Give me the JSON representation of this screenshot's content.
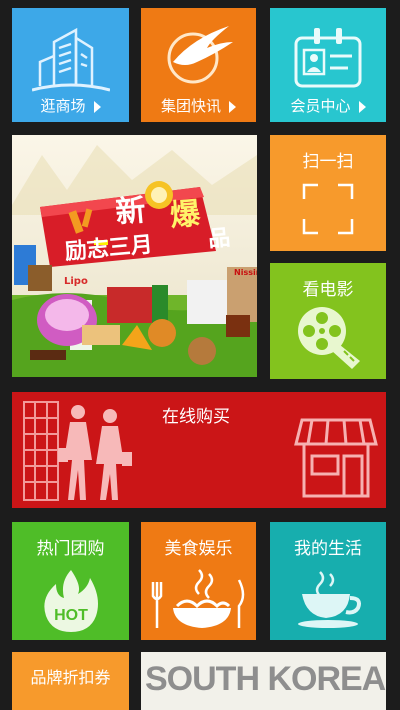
{
  "colors": {
    "background": "#1c1c1c",
    "mall": "#3da8e8",
    "news": "#ef7a14",
    "member": "#28c6cf",
    "scan": "#f79a2c",
    "movie": "#83c31e",
    "online": "#cb1517",
    "group": "#4fbd28",
    "food": "#ef7a14",
    "life": "#17aeae",
    "coupon": "#f79a2c",
    "promo": "#f5f5f0"
  },
  "tiles": {
    "mall": {
      "label": "逛商场",
      "icon": "building-icon"
    },
    "news": {
      "label": "集团快讯",
      "icon": "phoenix-logo-icon"
    },
    "member": {
      "label": "会员中心",
      "icon": "member-card-icon"
    },
    "scan": {
      "label": "扫一扫",
      "icon": "scan-frame-icon"
    },
    "movie": {
      "label": "看电影",
      "icon": "film-reel-icon"
    },
    "online": {
      "label": "在线购买",
      "icon": "shop-icon"
    },
    "group": {
      "label": "热门团购",
      "icon": "hot-flame-icon"
    },
    "food": {
      "label": "美食娱乐",
      "icon": "noodle-bowl-icon"
    },
    "life": {
      "label": "我的生活",
      "icon": "coffee-cup-icon"
    },
    "coupon": {
      "label": "品牌折扣券"
    },
    "promo": {
      "text": "SOUTH KOREA"
    }
  },
  "banner": {
    "headline_new": "新",
    "headline_main": "励志三月",
    "headline_burst": "爆",
    "headline_end": "品",
    "products": [
      "Lipo",
      "Nissin"
    ]
  }
}
